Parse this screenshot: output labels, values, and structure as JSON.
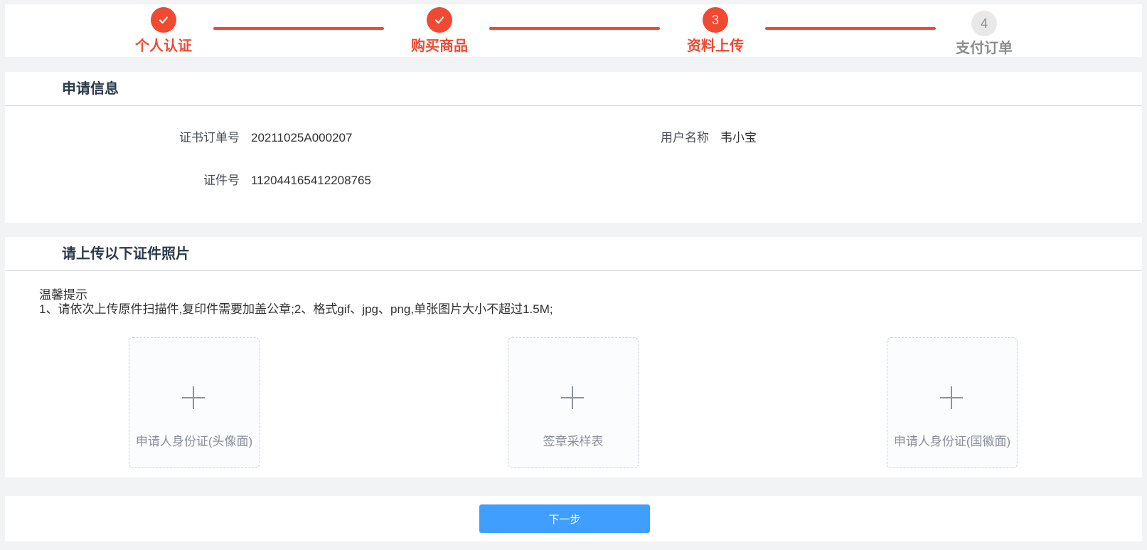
{
  "steps": [
    {
      "label": "个人认证",
      "status": "done",
      "marker": "check-icon"
    },
    {
      "label": "购买商品",
      "status": "done",
      "marker": "check-icon"
    },
    {
      "label": "资料上传",
      "status": "active",
      "number": "3"
    },
    {
      "label": "支付订单",
      "status": "todo",
      "number": "4"
    }
  ],
  "info": {
    "title": "申请信息",
    "order_no_label": "证书订单号",
    "order_no": "20211025A000207",
    "username_label": "用户名称",
    "username": "韦小宝",
    "id_label": "证件号",
    "id_no": "112044165412208765"
  },
  "upload": {
    "title": "请上传以下证件照片",
    "tip_title": "温馨提示",
    "tip_text": "1、请依次上传原件扫描件,复印件需要加盖公章;2、格式gif、jpg、png,单张图片大小不超过1.5M;",
    "items": [
      {
        "label": "申请人身份证(头像面)"
      },
      {
        "label": "签章采样表"
      },
      {
        "label": "申请人身份证(国徽面)"
      }
    ]
  },
  "footer": {
    "next_label": "下一步"
  },
  "colors": {
    "accent": "#f04a32",
    "primary_button": "#409eff",
    "todo_gray": "#8c8c8c"
  }
}
